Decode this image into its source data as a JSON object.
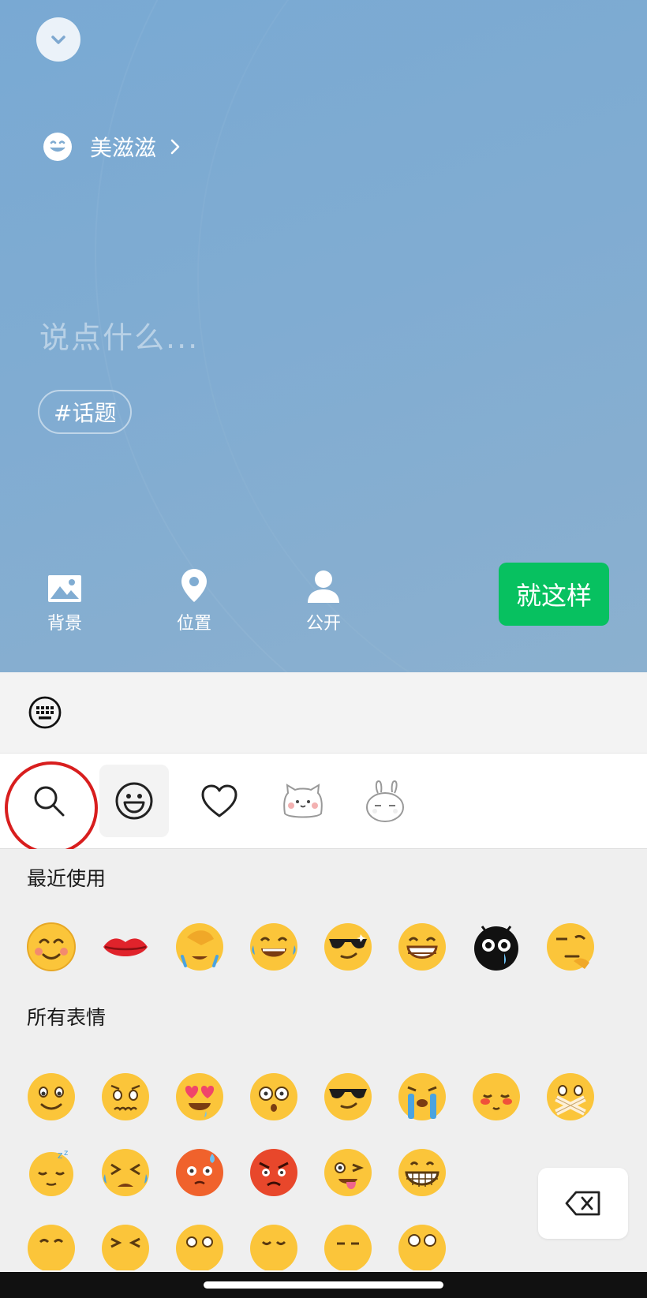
{
  "editor": {
    "status_name": "美滋滋",
    "input_placeholder": "说点什么...",
    "topic_chip": "#话题",
    "tools": [
      {
        "label": "背景",
        "icon": "image-icon"
      },
      {
        "label": "位置",
        "icon": "location-pin-icon"
      },
      {
        "label": "公开",
        "icon": "person-icon"
      }
    ],
    "done_label": "就这样"
  },
  "emoji_panel": {
    "tabs": [
      "search-icon",
      "smiley-face-icon",
      "heart-icon",
      "cat-sticker-icon",
      "rabbit-sticker-icon"
    ],
    "active_tab": "smiley-face-icon",
    "recent_title": "最近使用",
    "all_title": "所有表情",
    "recent": [
      "smile",
      "lips",
      "facepalm",
      "laugh-cry",
      "cool-sparkle",
      "grin",
      "black-cry",
      "smirk"
    ],
    "all": [
      "slight-smile",
      "worried",
      "heart-eyes",
      "shocked",
      "sunglasses",
      "sobbing",
      "blush",
      "mouth-tape",
      "sleepy",
      "tears-squint",
      "sweat-red",
      "angry",
      "tongue-wink",
      "big-grin",
      "partial-1",
      "partial-2",
      "partial-3",
      "partial-4",
      "partial-5",
      "partial-6"
    ]
  },
  "colors": {
    "accent_green": "#07c160",
    "annotation_red": "#d81e1e",
    "sky_blue": "#79a9d3"
  }
}
